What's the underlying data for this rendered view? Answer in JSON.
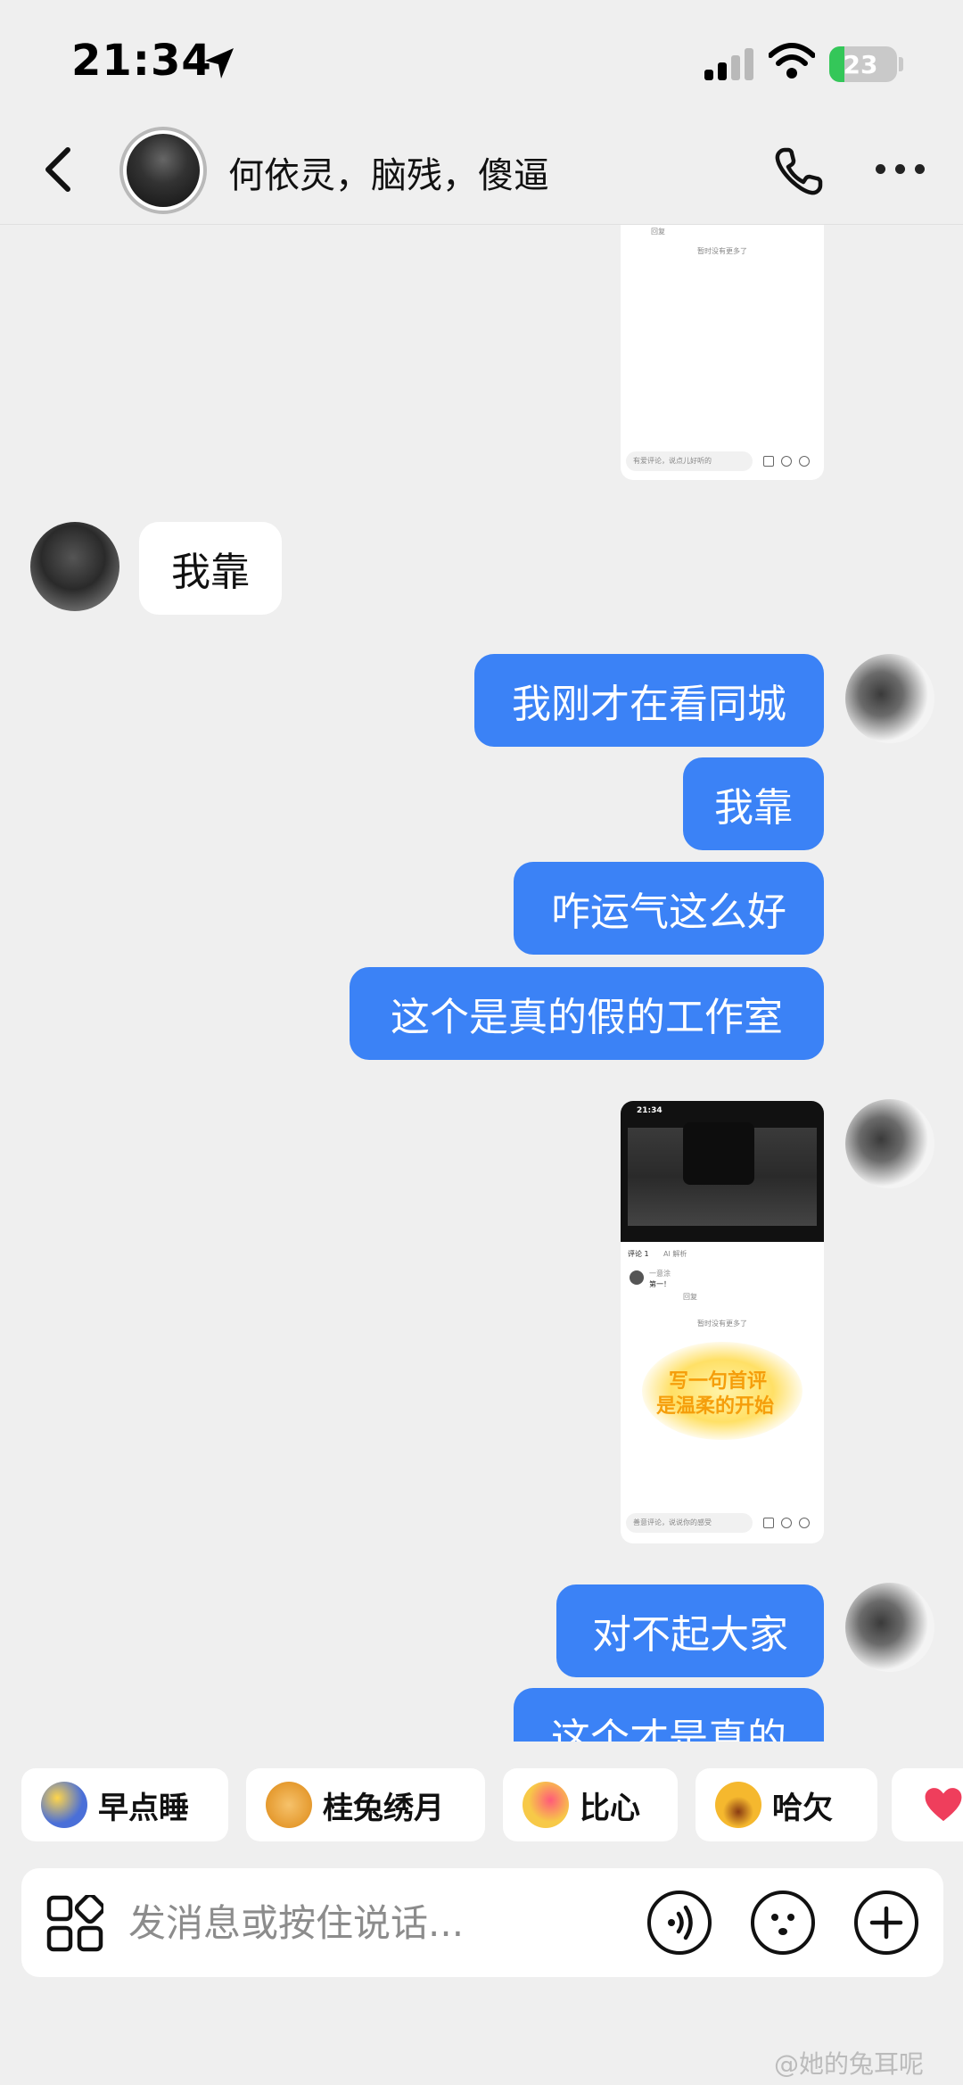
{
  "status_bar": {
    "time": "21:34",
    "battery": "23",
    "battery_level": 0.23
  },
  "header": {
    "title": "何依灵，脑残，傻逼"
  },
  "messages": {
    "shot1": {
      "no_more": "暂时没有更多了",
      "reply": "回复",
      "input": "有爱评论，说点儿好听的"
    },
    "received": "我靠",
    "sent1": "我刚才在看同城",
    "sent2": "我靠",
    "sent3": "咋运气这么好",
    "sent4": "这个是真的假的工作室",
    "shot2": {
      "time": "21:34",
      "tab_comments": "评论 1",
      "tab_ai": "AI 解析",
      "commenter": "一意涂",
      "comment": "第一！",
      "reply": "回复",
      "no_more": "暂时没有更多了",
      "promo_line1": "写一句首评",
      "promo_line2": "是温柔的开始",
      "input": "善意评论，说说你的感受"
    },
    "sent5": "对不起大家",
    "sent6": "这个才是真的"
  },
  "quick_reactions": [
    {
      "label": "早点睡",
      "icon": "moon-sleep-icon",
      "color": "#4a6fd8"
    },
    {
      "label": "桂兔绣月",
      "icon": "mooncake-icon",
      "color": "#e59a2f"
    },
    {
      "label": "比心",
      "icon": "heart-hands-icon",
      "color": "#f7c948"
    },
    {
      "label": "哈欠",
      "icon": "yawn-icon",
      "color": "#f5b82e"
    },
    {
      "label": "",
      "icon": "heart-icon",
      "color": "#ef3e5c"
    }
  ],
  "input": {
    "placeholder": "发消息或按住说话..."
  },
  "watermark": "@她的兔耳呢",
  "colors": {
    "sent_bubble": "#3b82f6",
    "background": "#efefef"
  }
}
